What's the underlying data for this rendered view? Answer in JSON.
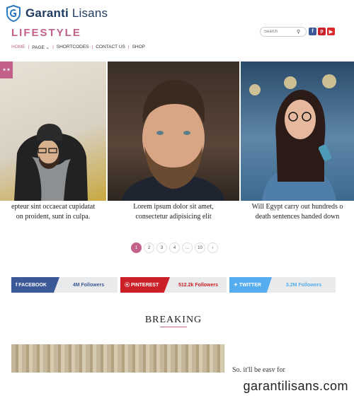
{
  "watermark": {
    "brand_bold": "Garanti",
    "brand_light": " Lisans",
    "footer_text": "garantilisans.com"
  },
  "header": {
    "site_title": "LIFESTYLE",
    "search_placeholder": "Search",
    "social_icons": [
      "facebook-icon",
      "pinterest-icon",
      "youtube-icon"
    ]
  },
  "nav": {
    "items": [
      "HOME",
      "PAGE",
      "SHORTCODES",
      "CONTACT US",
      "SHOP"
    ]
  },
  "slider": {
    "badge": "✶✶",
    "captions": [
      {
        "line1": "epteur sint occaecat cupidatat",
        "line2": "on proident, sunt in culpa."
      },
      {
        "line1": "Lorem ipsum dolor sit amet,",
        "line2": "consectetur adipisicing elit"
      },
      {
        "line1": "Will Egypt carry out hundreds o",
        "line2": "death sentences handed down"
      }
    ]
  },
  "pagination": {
    "pages": [
      "1",
      "2",
      "3",
      "4",
      "…",
      "10",
      "›"
    ],
    "active": "1"
  },
  "social_bars": {
    "facebook": {
      "label": "FACEBOOK",
      "count": "4M Followers",
      "color": "#3b5998"
    },
    "pinterest": {
      "label": "PINTEREST",
      "count": "512.2k Followers",
      "color": "#cb2027"
    },
    "twitter": {
      "label": "TWITTER",
      "count": "3.2M Followers",
      "color": "#55acee"
    }
  },
  "section": {
    "breaking_title": "BREAKING",
    "post_teaser": "So, it'll be easy for"
  },
  "colors": {
    "accent": "#c2608a",
    "brand_navy": "#1f3b63"
  }
}
